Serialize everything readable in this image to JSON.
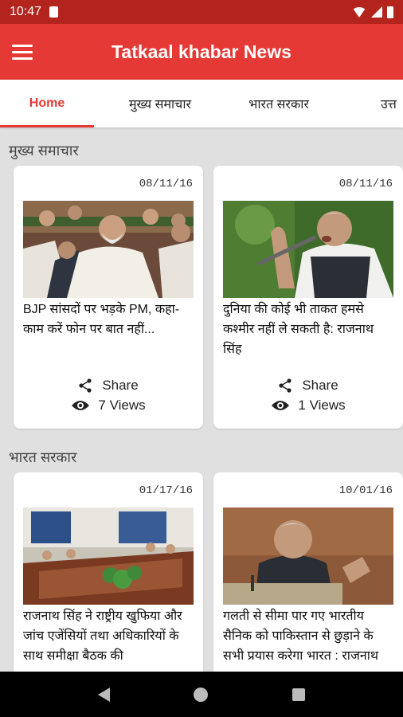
{
  "status_bar": {
    "time": "10:47"
  },
  "app_bar": {
    "title": "Tatkaal khabar News",
    "menu_icon": "hamburger-menu-icon"
  },
  "tabs": [
    {
      "label": "Home",
      "active": true
    },
    {
      "label": "मुख्य समाचार",
      "active": false
    },
    {
      "label": "भारत सरकार",
      "active": false
    },
    {
      "label": "उत्त",
      "active": false
    }
  ],
  "sections": [
    {
      "title": "मुख्य समाचार",
      "cards": [
        {
          "date": "08/11/16",
          "headline": "BJP सांसदों पर भड़के PM, कहा- काम करें फोन पर बात नहीं...",
          "share_label": "Share",
          "views_label": "7 Views",
          "image": "parliament-photo"
        },
        {
          "date": "08/11/16",
          "headline": "दुनिया की कोई भी ताकत हमसे कश्मीर नहीं ले सकती है: राजनाथ सिंह",
          "share_label": "Share",
          "views_label": "1 Views",
          "image": "speech-photo"
        }
      ]
    },
    {
      "title": "भारत सरकार",
      "cards": [
        {
          "date": "01/17/16",
          "headline": "राजनाथ सिंह ने राष्ट्रीय खुफिया और जांच एजेंसियों तथा अधिकारियों के साथ समीक्षा बैठक की",
          "image": "meeting-photo"
        },
        {
          "date": "10/01/16",
          "headline": "गलती से सीमा पार गए भारतीय सैनिक को पाकिस्तान से छुड़ाने के सभी प्रयास करेगा भारत : राजनाथ",
          "image": "podium-photo"
        }
      ]
    }
  ],
  "colors": {
    "primary": "#e53935",
    "status_bar": "#b3241c",
    "background": "#e0e0e0"
  }
}
